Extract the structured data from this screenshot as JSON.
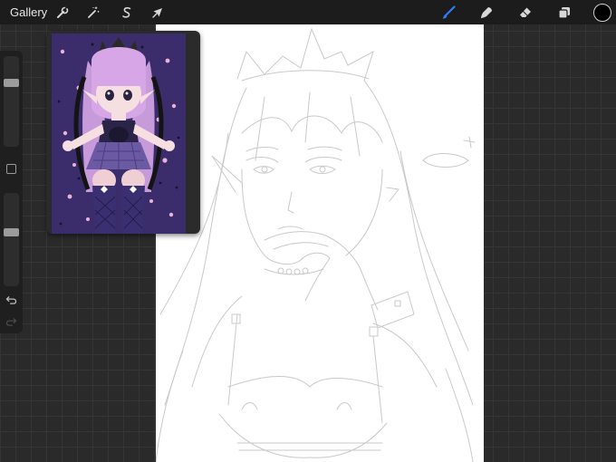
{
  "topbar": {
    "gallery_label": "Gallery",
    "actions_icon": "wrench-icon",
    "adjustments_icon": "magic-wand-icon",
    "selection_icon": "selection-s-icon",
    "transform_icon": "arrow-cursor-icon",
    "brush_icon": "brush-icon",
    "smudge_icon": "smudge-icon",
    "eraser_icon": "eraser-icon",
    "layers_icon": "layers-icon",
    "current_color": "#000000",
    "active_tool_color": "#2f7df6"
  },
  "sidebar": {
    "brush_size_level": 0.72,
    "opacity_level": 0.58,
    "undo_icon": "undo-icon",
    "redo_icon": "redo-icon"
  },
  "reference": {
    "background_color": "#3b2d6b",
    "hair_color": "#c79ad9",
    "skirt_color": "#6b5aa3"
  },
  "canvas": {
    "background_color": "#ffffff",
    "sketch_color": "#c9c9c9"
  }
}
